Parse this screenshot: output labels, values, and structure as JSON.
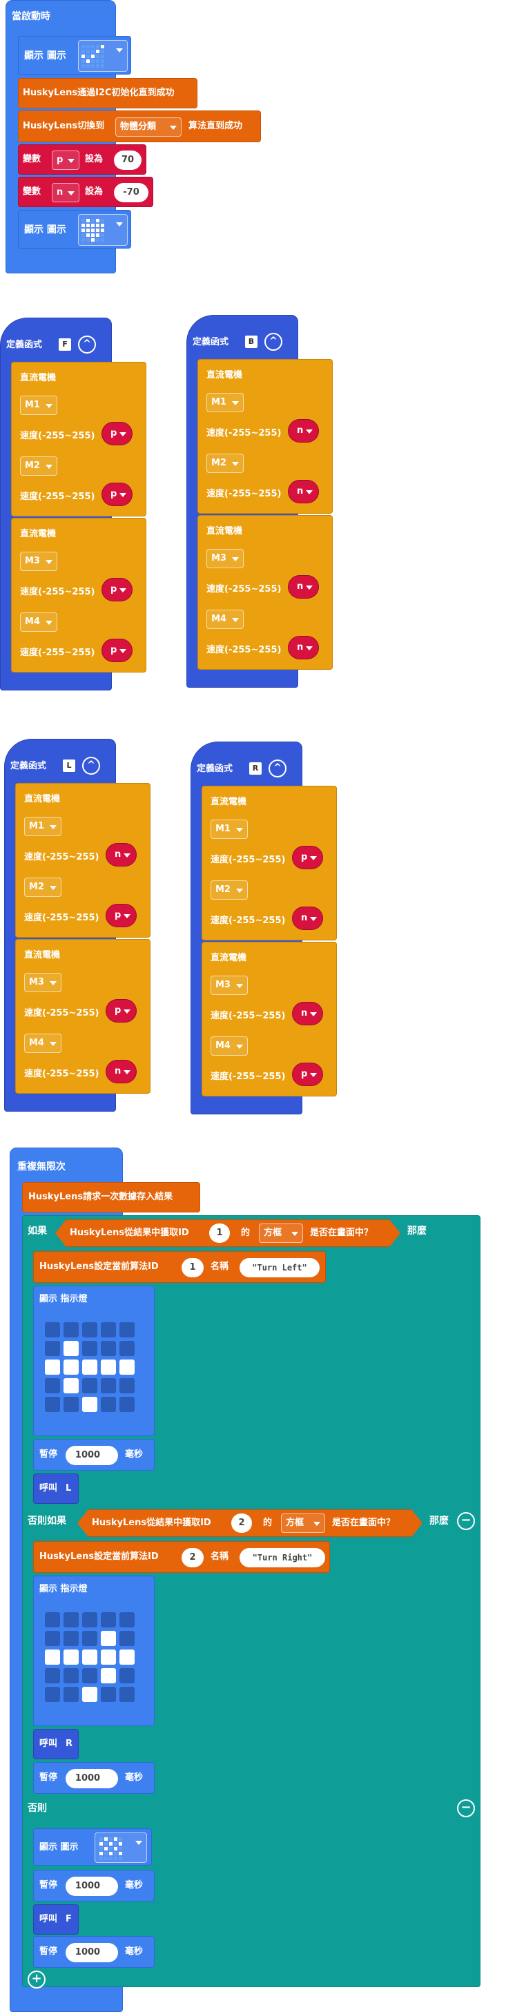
{
  "on_start": {
    "hat": "當啟動時",
    "show_icon": "顯示 圖示",
    "husky_init": "HuskyLens通過I2C初始化直到成功",
    "husky_switch_pre": "HuskyLens切換到",
    "husky_switch_algo": "物體分類",
    "husky_switch_post": "算法直到成功",
    "set_p_label": "變數",
    "set_p_var": "p",
    "set_p_to": "設為",
    "set_p_value": "70",
    "set_n_label": "變數",
    "set_n_var": "n",
    "set_n_to": "設為",
    "set_n_value": "-70"
  },
  "functions": [
    {
      "header": "定義函式",
      "name": "F",
      "m_title": "直流電機",
      "m1": "M1",
      "m2": "M2",
      "m3": "M3",
      "m4": "M4",
      "speed": "速度(-255~255)",
      "v1": "p",
      "v2": "p",
      "v3": "p",
      "v4": "p"
    },
    {
      "header": "定義函式",
      "name": "B",
      "m_title": "直流電機",
      "m1": "M1",
      "m2": "M2",
      "m3": "M3",
      "m4": "M4",
      "speed": "速度(-255~255)",
      "v1": "n",
      "v2": "n",
      "v3": "n",
      "v4": "n"
    },
    {
      "header": "定義函式",
      "name": "L",
      "m_title": "直流電機",
      "m1": "M1",
      "m2": "M2",
      "m3": "M3",
      "m4": "M4",
      "speed": "速度(-255~255)",
      "v1": "n",
      "v2": "p",
      "v3": "p",
      "v4": "n"
    },
    {
      "header": "定義函式",
      "name": "R",
      "m_title": "直流電機",
      "m1": "M1",
      "m2": "M2",
      "m3": "M3",
      "m4": "M4",
      "speed": "速度(-255~255)",
      "v1": "p",
      "v2": "n",
      "v3": "n",
      "v4": "p"
    }
  ],
  "forever": {
    "hat": "重複無限次",
    "request": "HuskyLens請求一次數據存入結果",
    "if_label": "如果",
    "then_label": "那麼",
    "elif_label": "否則如果",
    "else_label": "否則",
    "cond_pre": "HuskyLens從結果中獲取ID",
    "cond_mid": "的",
    "cond_box": "方框",
    "cond_post": "是否在畫面中？",
    "cond1_id": "1",
    "cond2_id": "2",
    "set_name_pre": "HuskyLens設定當前算法ID",
    "set_name_mid": "名稱",
    "name1_id": "1",
    "name1_text": "Turn Left",
    "name2_id": "2",
    "name2_text": "Turn Right",
    "show_leds": "顯示 指示燈",
    "pause": "暫停",
    "pause_value": "1000",
    "pause_unit": "毫秒",
    "call": "呼叫",
    "call1": "L",
    "call2": "R",
    "call3": "F",
    "show_icon": "顯示 圖示"
  }
}
